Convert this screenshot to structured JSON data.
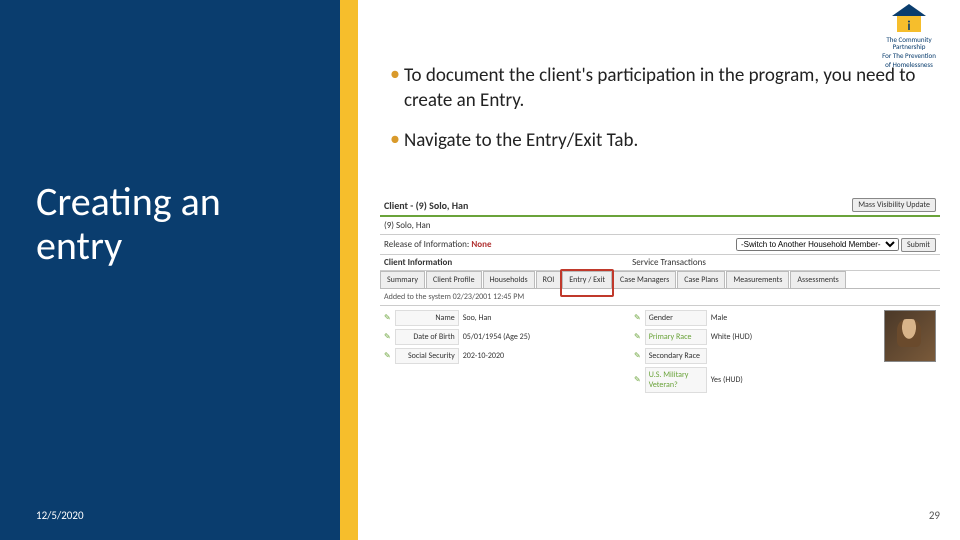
{
  "slide": {
    "title_line1": "Creating an",
    "title_line2": "entry",
    "date": "12/5/2020",
    "number": "29"
  },
  "logo": {
    "text_line1": "The Community Partnership",
    "text_line2": "For The Prevention",
    "text_line3": "of Homelessness"
  },
  "bullets": [
    "To document the client's participation in the program, you need to create an Entry.",
    "Navigate to the Entry/Exit Tab."
  ],
  "inset": {
    "client_header": "Client - (9) Solo, Han",
    "mass_vis": "Mass Visibility Update",
    "id_line": "(9) Solo, Han",
    "roi_label": "Release of Information:",
    "roi_value": "None",
    "switch_label": "-Switch to Another Household Member-",
    "submit": "Submit",
    "section_client_info": "Client Information",
    "section_service": "Service Transactions",
    "tabs": [
      "Summary",
      "Client Profile",
      "Households",
      "ROI",
      "Entry / Exit",
      "Case Managers",
      "Case Plans",
      "Measurements",
      "Assessments"
    ],
    "added": "Added to the system 02/23/2001 12:45 PM",
    "fields_left": [
      {
        "label": "Name",
        "value": "Soo, Han"
      },
      {
        "label": "Date of Birth",
        "value": "05/01/1954 (Age 25)"
      },
      {
        "label": "Social Security",
        "value": "202-10-2020"
      }
    ],
    "fields_right": [
      {
        "label": "Gender",
        "value": "Male"
      },
      {
        "label": "Primary Race",
        "value": "White (HUD)"
      },
      {
        "label": "Secondary Race",
        "value": ""
      },
      {
        "label": "U.S. Military Veteran?",
        "value": "Yes (HUD)"
      }
    ]
  }
}
